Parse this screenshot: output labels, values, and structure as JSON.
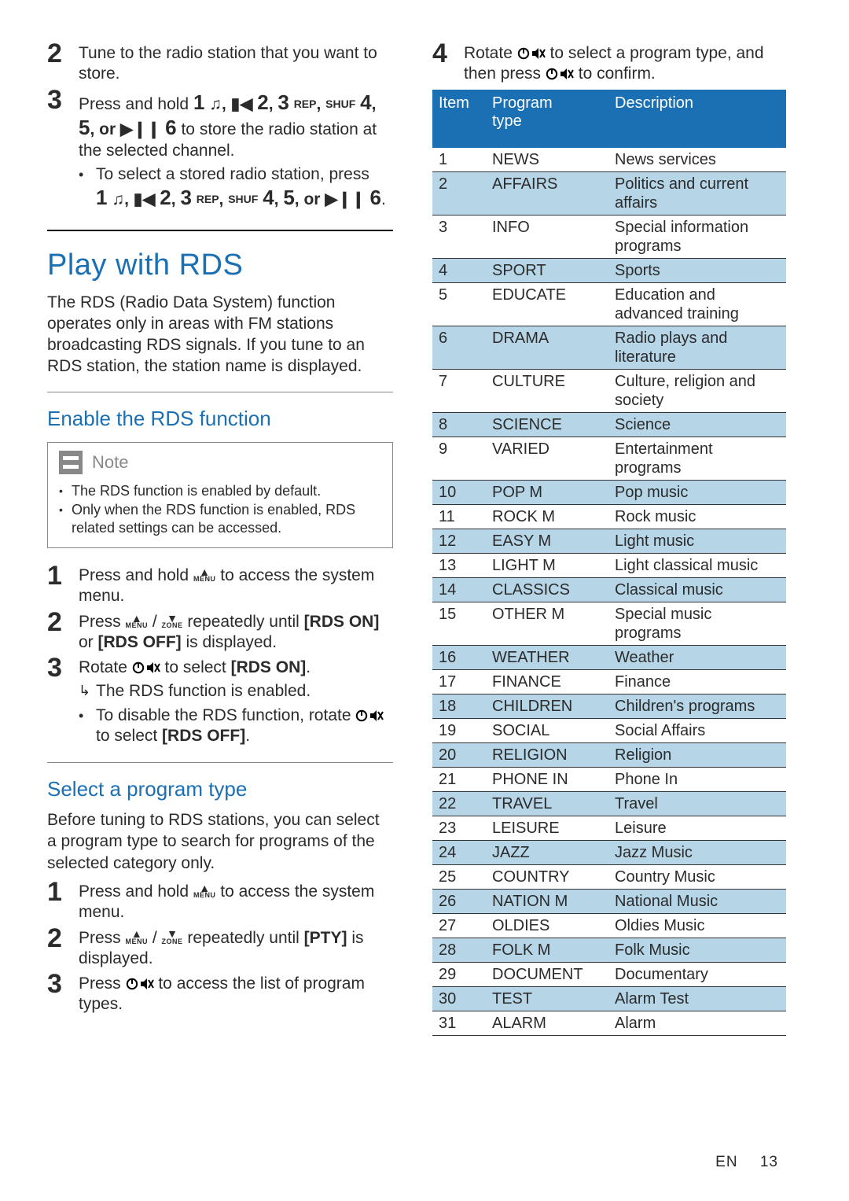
{
  "left": {
    "steps_a": [
      {
        "n": "2",
        "text": "Tune to the radio station that you want to store."
      },
      {
        "n": "3",
        "text_pre": "Press and hold ",
        "text_post": " to store the radio station at the selected channel.",
        "sub": [
          {
            "pre": "To select a stored radio station, press "
          }
        ]
      }
    ],
    "key_seq": "1 ♫, ▮◀ 2, 3 REP, SHUF 4, 5, or ▶❙❙ 6",
    "h1": "Play with RDS",
    "intro": "The RDS (Radio Data System) function operates only in areas with FM stations broadcasting RDS signals. If you tune to an RDS station, the station name is displayed.",
    "h2a": "Enable the RDS function",
    "note_label": "Note",
    "note_items": [
      "The RDS function is enabled by default.",
      "Only when the RDS function is enabled, RDS related settings can be accessed."
    ],
    "steps_b": [
      {
        "n": "1",
        "html": "Press and hold {MENU_UP} to access the system menu."
      },
      {
        "n": "2",
        "html": "Press {MENU_UP} / {ZONE_DN} repeatedly until <b>[RDS ON]</b> or <b>[RDS OFF]</b> is displayed."
      },
      {
        "n": "3",
        "html": "Rotate {ROT} to select <b>[RDS ON]</b>.",
        "result": "The RDS function is enabled.",
        "sub": "To disable the RDS function, rotate {ROT} to select <b>[RDS OFF]</b>."
      }
    ],
    "h2b": "Select a program type",
    "intro2": "Before tuning to RDS stations, you can select a program type to search for programs of the selected category only.",
    "steps_c": [
      {
        "n": "1",
        "html": "Press and hold {MENU_UP} to access the system menu."
      },
      {
        "n": "2",
        "html": "Press {MENU_UP} / {ZONE_DN} repeatedly until <b>[PTY]</b> is displayed."
      },
      {
        "n": "3",
        "html": "Press {ROT} to access the list of program types."
      }
    ]
  },
  "right": {
    "step4": {
      "n": "4",
      "html": "Rotate {ROT} to select a program type, and then press {ROT} to confirm."
    },
    "headers": [
      "Item",
      "Program type",
      "Description"
    ],
    "rows": [
      {
        "i": "1",
        "p": "NEWS",
        "d": "News services"
      },
      {
        "i": "2",
        "p": "AFFAIRS",
        "d": "Politics and current affairs"
      },
      {
        "i": "3",
        "p": "INFO",
        "d": "Special information programs"
      },
      {
        "i": "4",
        "p": "SPORT",
        "d": "Sports"
      },
      {
        "i": "5",
        "p": "EDUCATE",
        "d": "Education and advanced training"
      },
      {
        "i": "6",
        "p": "DRAMA",
        "d": "Radio plays and literature"
      },
      {
        "i": "7",
        "p": "CULTURE",
        "d": "Culture, religion and society"
      },
      {
        "i": "8",
        "p": "SCIENCE",
        "d": "Science"
      },
      {
        "i": "9",
        "p": "VARIED",
        "d": "Entertainment programs"
      },
      {
        "i": "10",
        "p": "POP M",
        "d": "Pop music"
      },
      {
        "i": "11",
        "p": "ROCK M",
        "d": "Rock music"
      },
      {
        "i": "12",
        "p": "EASY M",
        "d": "Light music"
      },
      {
        "i": "13",
        "p": "LIGHT M",
        "d": "Light classical music"
      },
      {
        "i": "14",
        "p": "CLASSICS",
        "d": "Classical music"
      },
      {
        "i": "15",
        "p": "OTHER M",
        "d": "Special music programs"
      },
      {
        "i": "16",
        "p": "WEATHER",
        "d": "Weather"
      },
      {
        "i": "17",
        "p": "FINANCE",
        "d": "Finance"
      },
      {
        "i": "18",
        "p": "CHILDREN",
        "d": "Children's programs"
      },
      {
        "i": "19",
        "p": "SOCIAL",
        "d": "Social Affairs"
      },
      {
        "i": "20",
        "p": "RELIGION",
        "d": "Religion"
      },
      {
        "i": "21",
        "p": "PHONE IN",
        "d": "Phone In"
      },
      {
        "i": "22",
        "p": "TRAVEL",
        "d": "Travel"
      },
      {
        "i": "23",
        "p": "LEISURE",
        "d": "Leisure"
      },
      {
        "i": "24",
        "p": "JAZZ",
        "d": "Jazz Music"
      },
      {
        "i": "25",
        "p": "COUNTRY",
        "d": "Country Music"
      },
      {
        "i": "26",
        "p": "NATION M",
        "d": "National Music"
      },
      {
        "i": "27",
        "p": "OLDIES",
        "d": "Oldies Music"
      },
      {
        "i": "28",
        "p": "FOLK M",
        "d": "Folk Music"
      },
      {
        "i": "29",
        "p": "DOCUMENT",
        "d": "Documentary"
      },
      {
        "i": "30",
        "p": "TEST",
        "d": "Alarm Test"
      },
      {
        "i": "31",
        "p": "ALARM",
        "d": "Alarm"
      }
    ]
  },
  "footer": {
    "lang": "EN",
    "page": "13"
  }
}
